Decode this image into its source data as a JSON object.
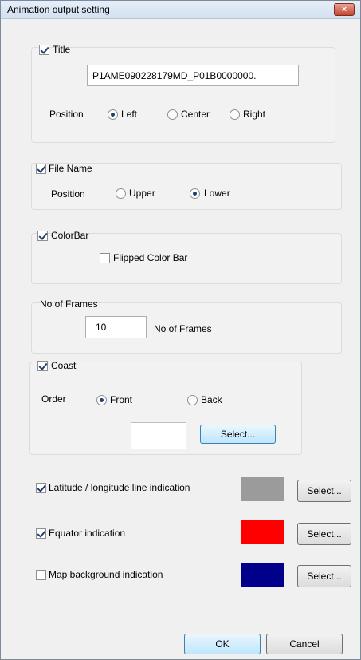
{
  "window": {
    "title": "Animation output setting",
    "close_glyph": "×"
  },
  "title_group": {
    "checkbox_label": "Title",
    "checked": true,
    "value": "P1AME090228179MD_P01B0000000.",
    "position_label": "Position",
    "options": [
      "Left",
      "Center",
      "Right"
    ],
    "selected": "Left"
  },
  "filename_group": {
    "checkbox_label": "File Name",
    "checked": true,
    "position_label": "Position",
    "options": [
      "Upper",
      "Lower"
    ],
    "selected": "Lower"
  },
  "colorbar_group": {
    "checkbox_label": "ColorBar",
    "checked": true,
    "flipped_label": "Flipped Color Bar",
    "flipped_checked": false
  },
  "frames_group": {
    "header": "No of Frames",
    "value": "10",
    "unit_label": "No of Frames"
  },
  "coast_group": {
    "checkbox_label": "Coast",
    "checked": true,
    "order_label": "Order",
    "options": [
      "Front",
      "Back"
    ],
    "selected": "Front",
    "color": "#ffffff",
    "select_label": "Select..."
  },
  "indications": [
    {
      "label": "Latitude / longitude line indication",
      "checked": true,
      "color": "#9b9b9b",
      "select_label": "Select..."
    },
    {
      "label": "Equator indication",
      "checked": true,
      "color": "#ff0000",
      "select_label": "Select..."
    },
    {
      "label": "Map background indication",
      "checked": false,
      "color": "#00008b",
      "select_label": "Select..."
    }
  ],
  "footer": {
    "ok_label": "OK",
    "cancel_label": "Cancel"
  }
}
